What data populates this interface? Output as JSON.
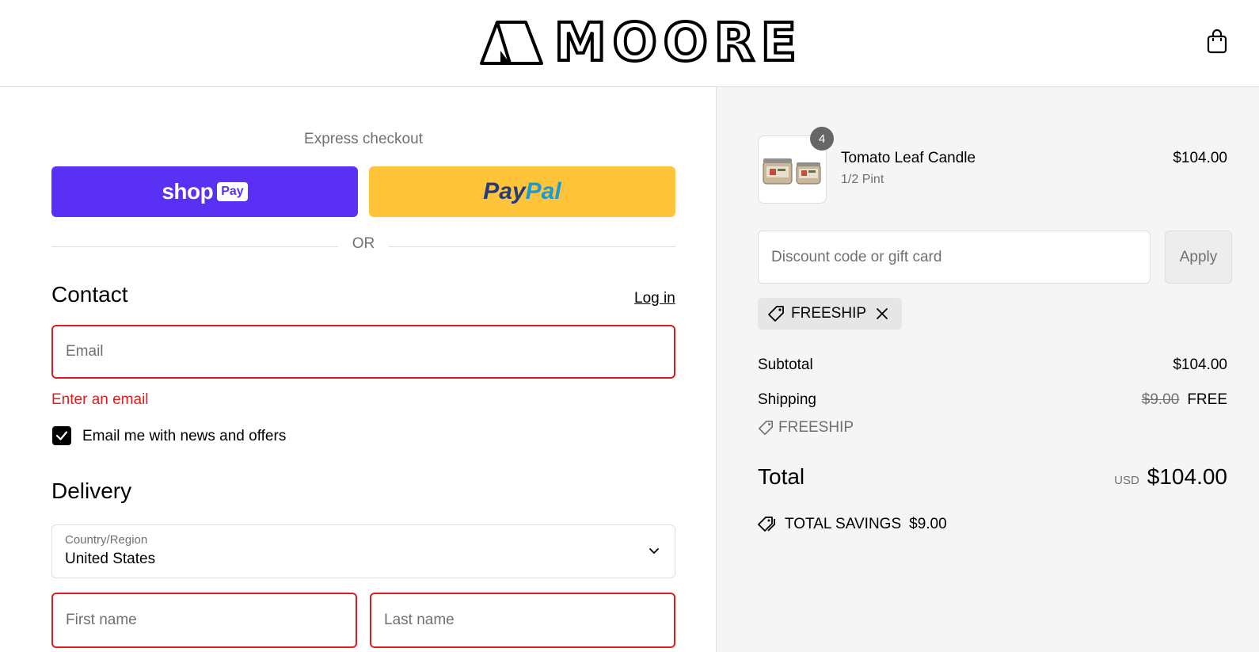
{
  "header": {
    "brand": "MOORE",
    "cart_icon": "shopping-bag-icon"
  },
  "express": {
    "title": "Express checkout",
    "shop_pay_word": "shop",
    "shop_pay_chip": "Pay",
    "paypal_part1": "Pay",
    "paypal_part2": "Pal",
    "divider": "OR",
    "shop_pay_color": "#5a31f4",
    "paypal_color": "#ffc439"
  },
  "contact": {
    "title": "Contact",
    "login_link": "Log in",
    "email_placeholder": "Email",
    "email_error": "Enter an email",
    "newsletter_label": "Email me with news and offers",
    "newsletter_checked": true
  },
  "delivery": {
    "title": "Delivery",
    "country_label": "Country/Region",
    "country_value": "United States",
    "first_name_placeholder": "First name",
    "last_name_placeholder": "Last name"
  },
  "order": {
    "item": {
      "name": "Tomato Leaf Candle",
      "variant": "1/2 Pint",
      "price": "$104.00",
      "quantity": "4"
    },
    "discount_placeholder": "Discount code or gift card",
    "apply_label": "Apply",
    "applied_code": "FREESHIP",
    "subtotal_label": "Subtotal",
    "subtotal_value": "$104.00",
    "shipping_label": "Shipping",
    "shipping_original": "$9.00",
    "shipping_value": "FREE",
    "shipping_code": "FREESHIP",
    "total_label": "Total",
    "currency": "USD",
    "total_value": "$104.00",
    "savings_label": "TOTAL SAVINGS",
    "savings_value": "$9.00"
  },
  "colors": {
    "error": "#dd1d1d",
    "muted": "#707070",
    "border": "#dedede"
  }
}
